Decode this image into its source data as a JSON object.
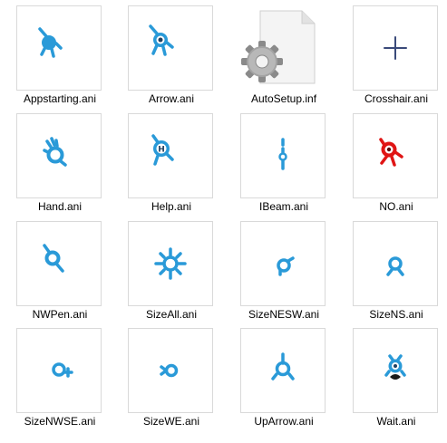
{
  "files": [
    {
      "name": "Appstarting.ani",
      "icon": "appstarting-cursor-icon"
    },
    {
      "name": "Arrow.ani",
      "icon": "arrow-cursor-icon"
    },
    {
      "name": "AutoSetup.inf",
      "icon": "setup-info-file-icon"
    },
    {
      "name": "Crosshair.ani",
      "icon": "crosshair-cursor-icon"
    },
    {
      "name": "Hand.ani",
      "icon": "hand-cursor-icon"
    },
    {
      "name": "Help.ani",
      "icon": "help-cursor-icon"
    },
    {
      "name": "IBeam.ani",
      "icon": "ibeam-cursor-icon"
    },
    {
      "name": "NO.ani",
      "icon": "no-cursor-icon"
    },
    {
      "name": "NWPen.ani",
      "icon": "nwpen-cursor-icon"
    },
    {
      "name": "SizeAll.ani",
      "icon": "sizeall-cursor-icon"
    },
    {
      "name": "SizeNESW.ani",
      "icon": "sizenesw-cursor-icon"
    },
    {
      "name": "SizeNS.ani",
      "icon": "sizens-cursor-icon"
    },
    {
      "name": "SizeNWSE.ani",
      "icon": "sizenwse-cursor-icon"
    },
    {
      "name": "SizeWE.ani",
      "icon": "sizewe-cursor-icon"
    },
    {
      "name": "UpArrow.ani",
      "icon": "uparrow-cursor-icon"
    },
    {
      "name": "Wait.ani",
      "icon": "wait-cursor-icon"
    }
  ],
  "colors": {
    "cursor_blue": "#2a9ad8",
    "cursor_dark": "#1f3f5f",
    "no_red": "#e01515",
    "crosshair": "#3a4a7a",
    "thumb_border": "#d9d9d9"
  }
}
